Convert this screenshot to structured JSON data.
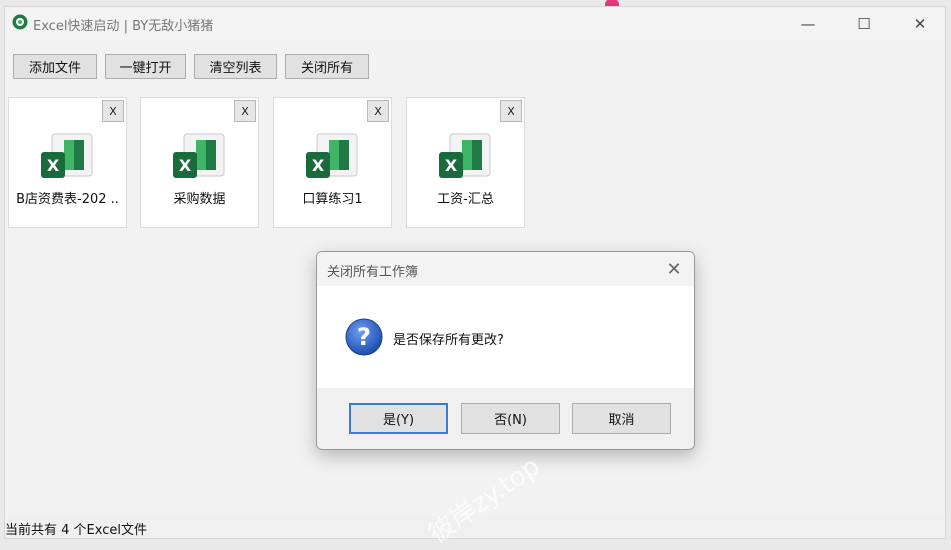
{
  "window": {
    "title": "Excel快速启动 | BY无敌小猪猪",
    "minimize_glyph": "—",
    "maximize_glyph": "☐",
    "close_glyph": "✕"
  },
  "toolbar": {
    "add_file": "添加文件",
    "open_all": "一键打开",
    "clear_list": "清空列表",
    "close_all": "关闭所有"
  },
  "files": [
    {
      "name": "B店资费表-202 ..",
      "close": "X"
    },
    {
      "name": "采购数据",
      "close": "X"
    },
    {
      "name": "口算练习1",
      "close": "X"
    },
    {
      "name": "工资-汇总",
      "close": "X"
    }
  ],
  "status": {
    "text": "当前共有 4 个Excel文件"
  },
  "dialog": {
    "title": "关闭所有工作簿",
    "close_glyph": "✕",
    "message": "是否保存所有更改?",
    "yes": "是(Y)",
    "no": "否(N)",
    "cancel": "取消"
  },
  "watermark": {
    "text": "彼岸zy.top"
  },
  "colors": {
    "excel_green": "#1f7a45",
    "excel_light_green": "#3fb566",
    "question_blue": "#2a5fc0",
    "accent_pink": "#e8357a"
  }
}
